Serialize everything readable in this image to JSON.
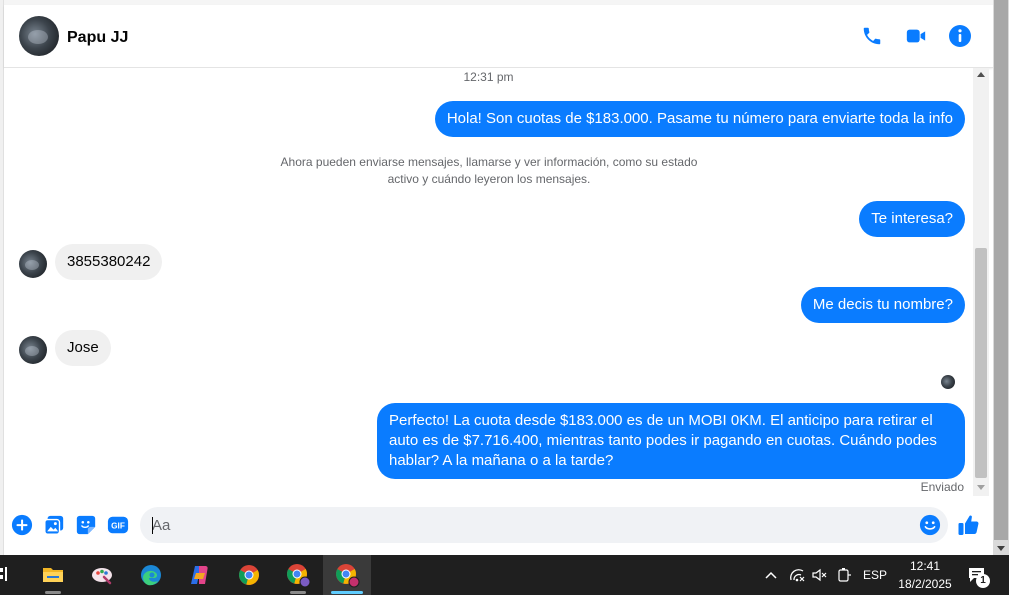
{
  "header": {
    "contact_name": "Papu JJ"
  },
  "conversation": {
    "timestamp": "12:31 pm",
    "system_message": "Ahora pueden enviarse mensajes, llamarse y ver información, como su estado activo y cuándo leyeron los mensajes.",
    "messages": [
      {
        "direction": "out",
        "text": "Hola! Son cuotas de $183.000. Pasame tu número para enviarte toda la info"
      },
      {
        "direction": "out",
        "text": "Te interesa?"
      },
      {
        "direction": "in",
        "text": "3855380242"
      },
      {
        "direction": "out",
        "text": "Me decis tu nombre?"
      },
      {
        "direction": "in",
        "text": "Jose"
      },
      {
        "direction": "out",
        "text": "Perfecto! La cuota desde $183.000 es de un MOBI 0KM. El anticipo para retirar el auto es de $7.716.400, mientras tanto podes ir pagando en cuotas. Cuándo podes hablar? A la mañana o a la tarde?"
      }
    ],
    "status": "Enviado"
  },
  "composer": {
    "placeholder": "Aa"
  },
  "taskbar": {
    "language": "ESP",
    "time": "12:41",
    "date": "18/2/2025",
    "notification_count": "1"
  },
  "colors": {
    "accent": "#0a7cff",
    "incoming_bubble": "#f0f0f0",
    "taskbar": "#1f1f1f"
  }
}
